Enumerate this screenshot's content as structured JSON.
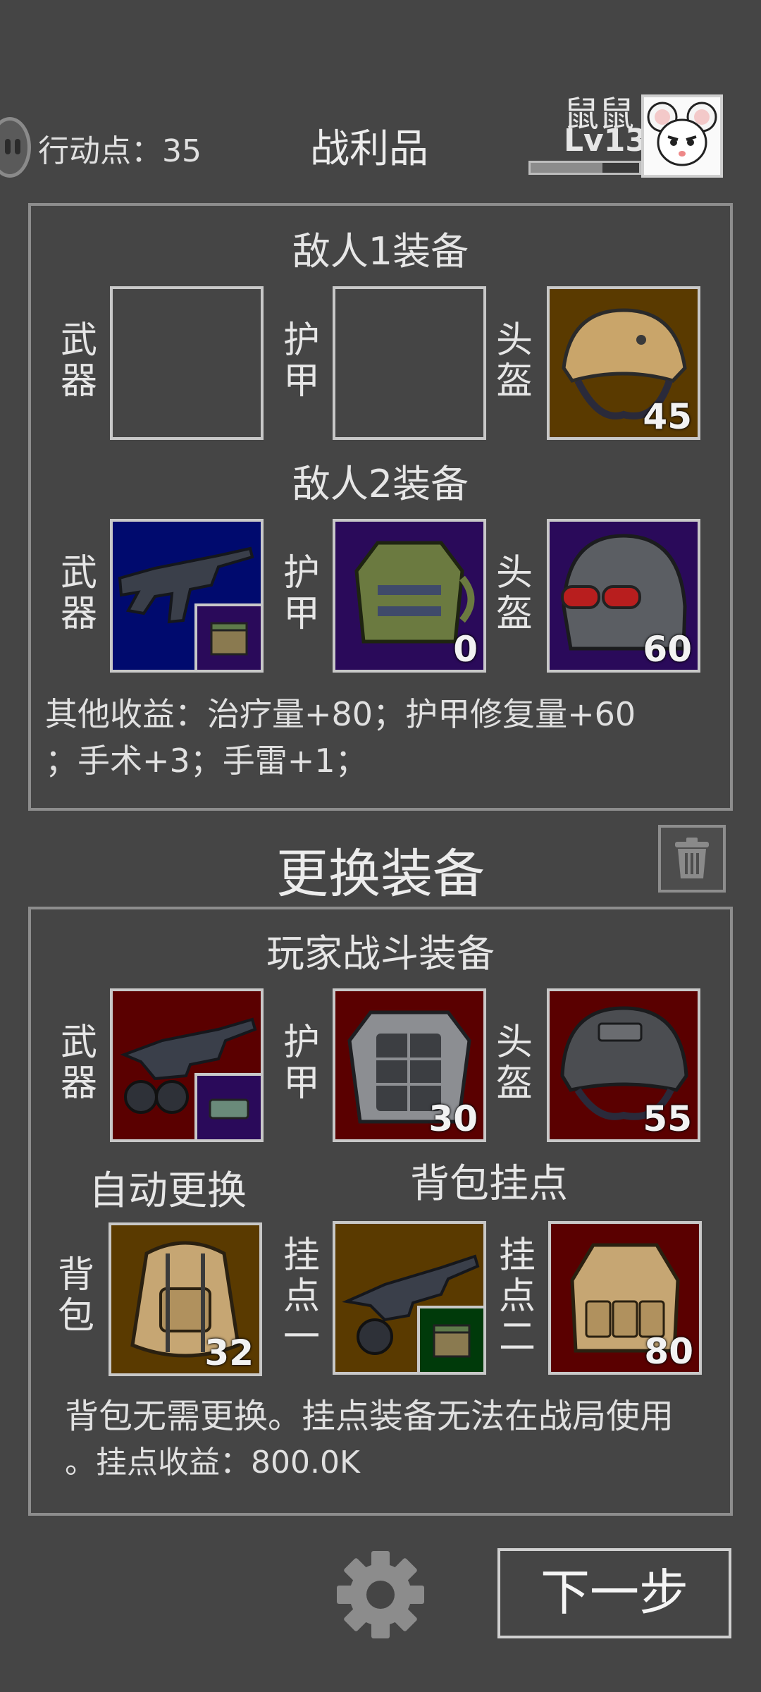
{
  "header": {
    "action_points_label": "行动点：35",
    "title": "战利品",
    "player_name": "鼠鼠",
    "player_level": "Lv13",
    "xp_progress": 0.66
  },
  "enemy1": {
    "title": "敌人1装备",
    "weapon_label": "武器",
    "armor_label": "护甲",
    "helmet_label": "头盔",
    "helmet_value": "45"
  },
  "enemy2": {
    "title": "敌人2装备",
    "weapon_label": "武器",
    "armor_label": "护甲",
    "armor_value": "0",
    "helmet_label": "头盔",
    "helmet_value": "60"
  },
  "other_income": {
    "line1": "其他收益：治疗量+80；护甲修复量+60",
    "line2": "；手术+3；手雷+1；"
  },
  "swap": {
    "title": "更换装备"
  },
  "player_gear": {
    "title": "玩家战斗装备",
    "weapon_label": "武器",
    "armor_label": "护甲",
    "armor_value": "30",
    "helmet_label": "头盔",
    "helmet_value": "55",
    "auto_swap_label": "自动更换",
    "backpack_mount_title": "背包挂点",
    "backpack_label": "背包",
    "backpack_value": "32",
    "mount1_label": "挂点一",
    "mount2_label": "挂点二",
    "mount2_value": "80",
    "note_line1": "背包无需更换。挂点装备无法在战局使用",
    "note_line2": "。挂点收益：800.0K"
  },
  "footer": {
    "next_label": "下一步"
  },
  "colors": {
    "background": "#454545",
    "rarity_brown": "#5a3a00",
    "rarity_blue": "#000a6e",
    "rarity_purple": "#2a0a5a",
    "rarity_red": "#5a0000",
    "rarity_green": "#003a0a"
  },
  "icons": [
    "action-point-icon",
    "avatar-mouse-icon",
    "trash-icon",
    "gear-icon"
  ]
}
